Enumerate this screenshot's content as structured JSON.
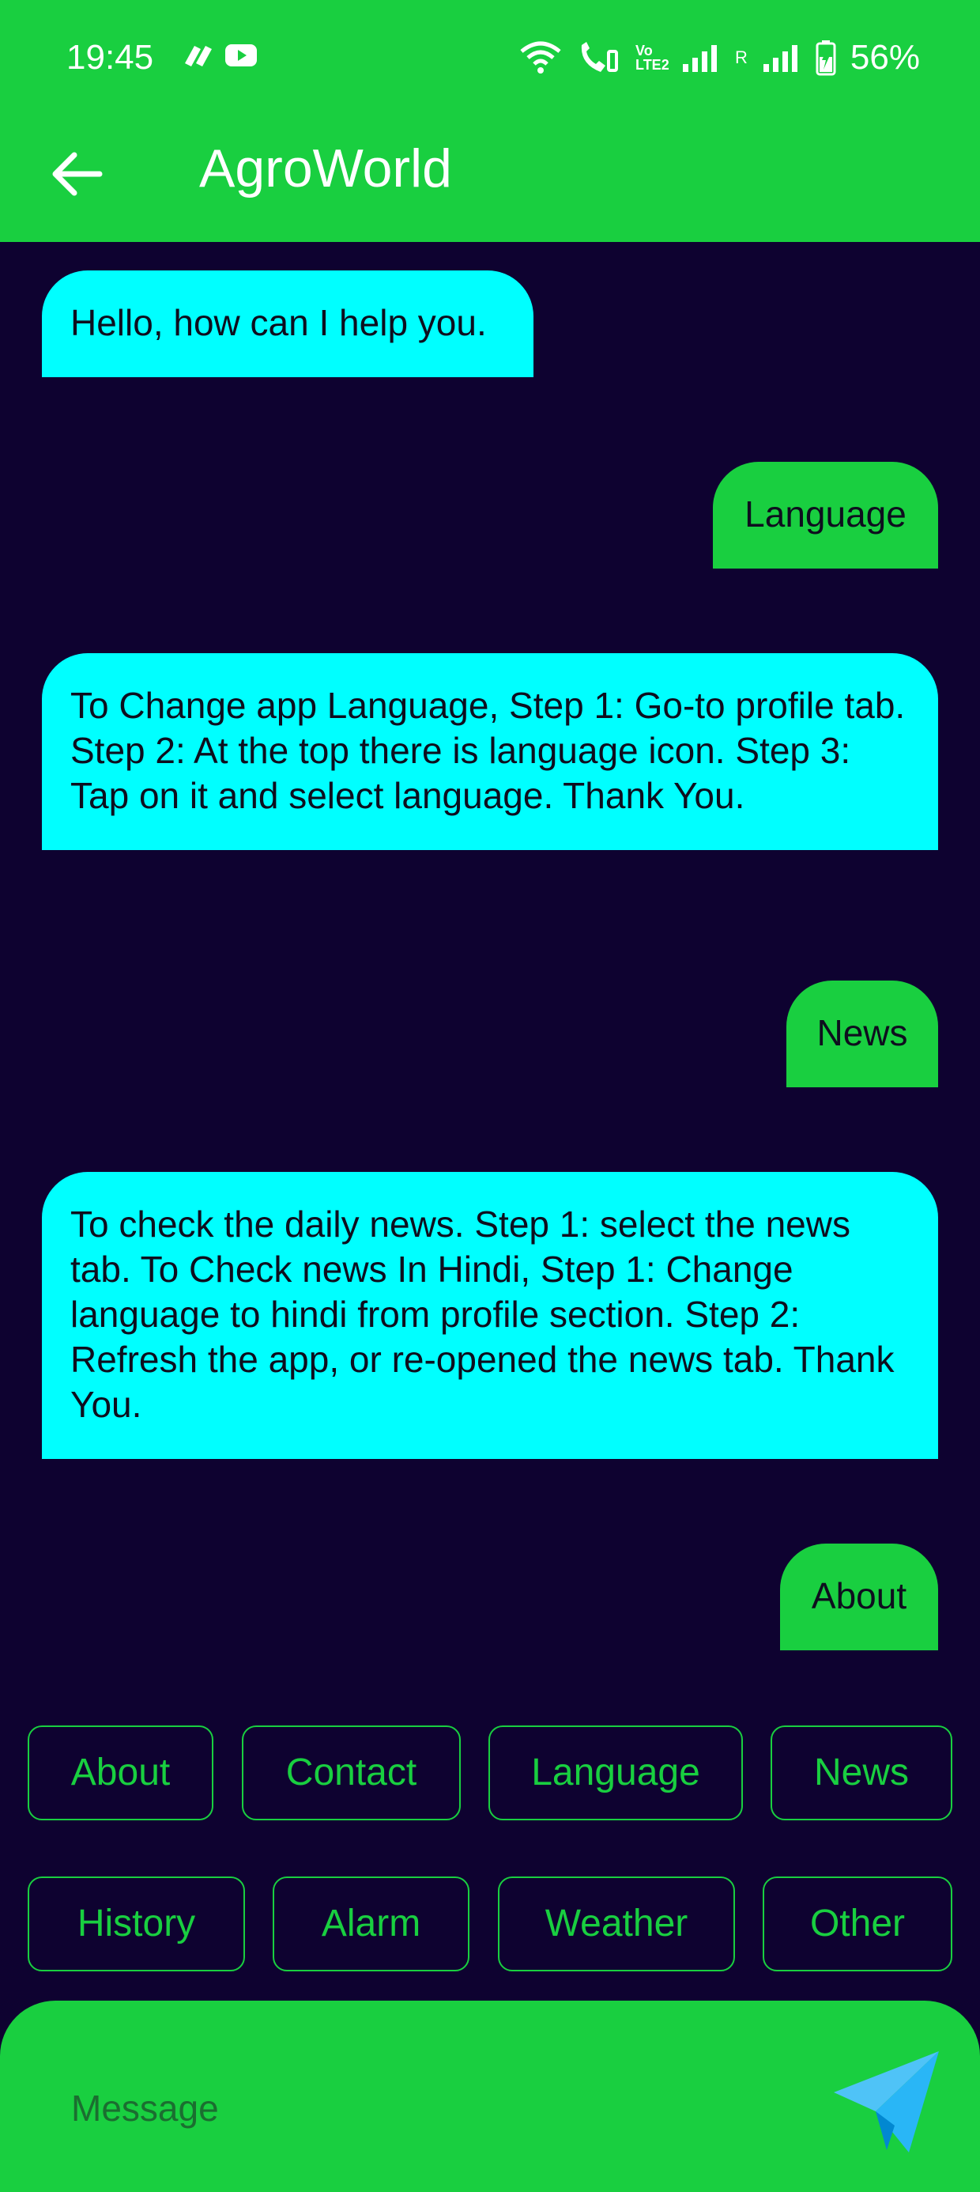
{
  "status_bar": {
    "time": "19:45",
    "battery": "56%",
    "icons": [
      "pinwheel-app-icon",
      "youtube-icon",
      "wifi-icon",
      "wifi-calling-icon",
      "volte-icon",
      "signal-icon",
      "signal-roaming-icon",
      "battery-charging-icon"
    ],
    "roaming_label": "R",
    "volte_label": "Vo LTE2"
  },
  "app_bar": {
    "title": "AgroWorld",
    "back_icon": "arrow-left-icon"
  },
  "messages": [
    {
      "sender": "bot",
      "text": "Hello, how can I help you."
    },
    {
      "sender": "user",
      "text": "Language"
    },
    {
      "sender": "bot",
      "text": "To Change app Language, Step 1: Go-to profile tab. Step 2: At the top there is language icon. Step 3: Tap on it and select language. Thank You."
    },
    {
      "sender": "user",
      "text": "News"
    },
    {
      "sender": "bot",
      "text": "To check the daily news. Step 1: select the news tab. To Check news In Hindi, Step 1: Change language to hindi from profile section. Step 2: Refresh the app, or re-opened the news tab. Thank You."
    },
    {
      "sender": "user",
      "text": "About"
    }
  ],
  "quick_replies": {
    "row1": [
      "About",
      "Contact",
      "Language",
      "News"
    ],
    "row2": [
      "History",
      "Alarm",
      "Weather",
      "Other"
    ]
  },
  "composer": {
    "placeholder": "Message",
    "send_icon": "paper-plane-icon"
  },
  "colors": {
    "primary_green": "#19cf40",
    "background": "#0e0230",
    "bot_bubble": "#00ffff",
    "send_icon": "#29b6f6"
  }
}
